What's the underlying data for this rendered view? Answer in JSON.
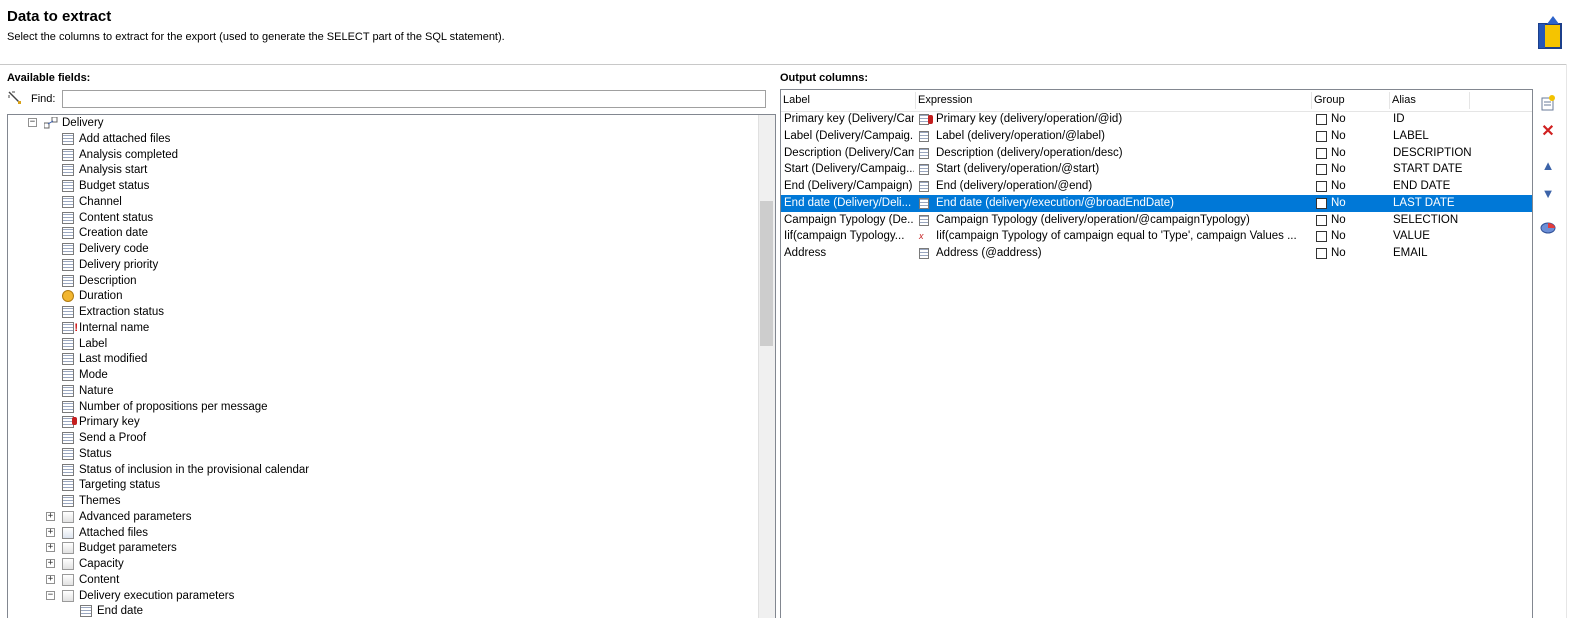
{
  "header": {
    "title": "Data to extract",
    "subtitle": "Select the columns to extract for the export (used to generate the SELECT part of the SQL statement)."
  },
  "left": {
    "section_label": "Available fields:",
    "find_label": "Find:",
    "find_value": ""
  },
  "tree": {
    "root": "Delivery",
    "fields": [
      {
        "label": "Add attached files",
        "icon": "field-icon"
      },
      {
        "label": "Analysis completed",
        "icon": "field-icon"
      },
      {
        "label": "Analysis start",
        "icon": "field-icon"
      },
      {
        "label": "Budget status",
        "icon": "field-icon"
      },
      {
        "label": "Channel",
        "icon": "field-icon"
      },
      {
        "label": "Content status",
        "icon": "field-icon"
      },
      {
        "label": "Creation date",
        "icon": "field-icon"
      },
      {
        "label": "Delivery code",
        "icon": "field-icon"
      },
      {
        "label": "Delivery priority",
        "icon": "field-icon"
      },
      {
        "label": "Description",
        "icon": "field-icon"
      },
      {
        "label": "Duration",
        "icon": "duration-icon"
      },
      {
        "label": "Extraction status",
        "icon": "field-icon"
      },
      {
        "label": "Internal name",
        "icon": "mandatory-field-icon"
      },
      {
        "label": "Label",
        "icon": "field-icon"
      },
      {
        "label": "Last modified",
        "icon": "field-icon"
      },
      {
        "label": "Mode",
        "icon": "field-icon"
      },
      {
        "label": "Nature",
        "icon": "field-icon"
      },
      {
        "label": "Number of propositions per message",
        "icon": "field-icon"
      },
      {
        "label": "Primary key",
        "icon": "primary-key-icon"
      },
      {
        "label": "Send a Proof",
        "icon": "field-icon"
      },
      {
        "label": "Status",
        "icon": "field-icon"
      },
      {
        "label": "Status of inclusion in the provisional calendar",
        "icon": "field-icon"
      },
      {
        "label": "Targeting status",
        "icon": "field-icon"
      },
      {
        "label": "Themes",
        "icon": "field-icon"
      }
    ],
    "nodes": [
      {
        "label": "Advanced parameters",
        "icon": "folder-icon",
        "expander": "+"
      },
      {
        "label": "Attached files",
        "icon": "attached-files-icon",
        "expander": "+"
      },
      {
        "label": "Budget parameters",
        "icon": "folder-icon",
        "expander": "+"
      },
      {
        "label": "Capacity",
        "icon": "folder-icon",
        "expander": "+"
      },
      {
        "label": "Content",
        "icon": "folder-icon",
        "expander": "+"
      },
      {
        "label": "Delivery execution parameters",
        "icon": "folder-icon",
        "expander": "−"
      }
    ],
    "partial_child": "End date"
  },
  "output": {
    "section_label": "Output columns:",
    "columns": {
      "label": "Label",
      "expression": "Expression",
      "group": "Group",
      "alias": "Alias"
    },
    "rows": [
      {
        "label": "Primary key (Delivery/Cam",
        "expression": "Primary key (delivery/operation/@id)",
        "expr_icon": "primary-key-icon",
        "group": "No",
        "alias": "ID"
      },
      {
        "label": "Label (Delivery/Campaig...",
        "expression": "Label (delivery/operation/@label)",
        "expr_icon": "field-icon",
        "group": "No",
        "alias": "LABEL"
      },
      {
        "label": "Description (Delivery/Cam",
        "expression": "Description (delivery/operation/desc)",
        "expr_icon": "field-icon",
        "group": "No",
        "alias": "DESCRIPTION"
      },
      {
        "label": "Start (Delivery/Campaig...",
        "expression": "Start (delivery/operation/@start)",
        "expr_icon": "field-icon",
        "group": "No",
        "alias": "START DATE"
      },
      {
        "label": "End (Delivery/Campaign)",
        "expression": "End (delivery/operation/@end)",
        "expr_icon": "field-icon",
        "group": "No",
        "alias": "END DATE"
      },
      {
        "label": "End date (Delivery/Deli...",
        "expression": "End date (delivery/execution/@broadEndDate)",
        "expr_icon": "field-icon",
        "group": "No",
        "alias": "LAST DATE",
        "selected": true
      },
      {
        "label": "Campaign Typology (De...",
        "expression": "Campaign Typology (delivery/operation/@campaignTypology)",
        "expr_icon": "field-icon",
        "group": "No",
        "alias": "SELECTION"
      },
      {
        "label": "Iif(campaign Typology...",
        "expression": "Iif(campaign Typology of campaign equal to 'Type', campaign Values ...",
        "expr_icon": "function-icon",
        "group": "No",
        "alias": "VALUE"
      },
      {
        "label": "Address",
        "expression": "Address (@address)",
        "expr_icon": "field-icon",
        "group": "No",
        "alias": "EMAIL"
      }
    ]
  },
  "colors": {
    "selection": "#0078d7",
    "delete": "#d02020",
    "arrow": "#3c63a8"
  }
}
